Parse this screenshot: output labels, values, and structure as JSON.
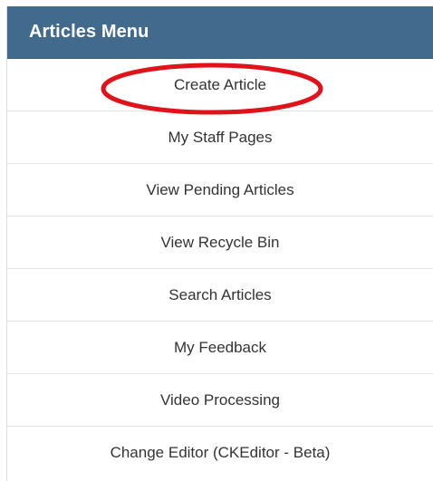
{
  "header": {
    "title": "Articles Menu"
  },
  "menu": {
    "items": [
      {
        "label": "Create Article"
      },
      {
        "label": "My Staff Pages"
      },
      {
        "label": "View Pending Articles"
      },
      {
        "label": "View Recycle Bin"
      },
      {
        "label": "Search Articles"
      },
      {
        "label": "My Feedback"
      },
      {
        "label": "Video Processing"
      },
      {
        "label": "Change Editor (CKEditor - Beta)"
      }
    ]
  },
  "colors": {
    "header_bg": "#426a8c",
    "annotation_ring": "#e0121a"
  }
}
